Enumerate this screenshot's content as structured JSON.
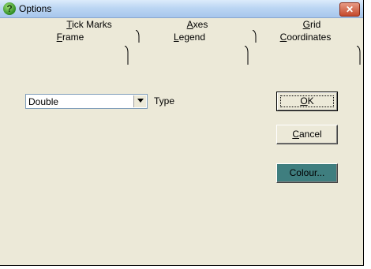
{
  "window": {
    "title": "Options"
  },
  "tabs_back": [
    {
      "mnemonic": "T",
      "rest": "ick Marks"
    },
    {
      "mnemonic": "A",
      "rest": "xes"
    },
    {
      "mnemonic": "G",
      "rest": "rid"
    }
  ],
  "tabs_front": [
    {
      "mnemonic": "F",
      "rest": "rame"
    },
    {
      "mnemonic": "L",
      "rest": "egend"
    },
    {
      "mnemonic": "C",
      "rest": "oordinates"
    }
  ],
  "frame": {
    "type_select": {
      "value": "Double"
    },
    "type_label": "Type"
  },
  "buttons": {
    "ok": {
      "mnemonic": "O",
      "rest": "K"
    },
    "cancel": {
      "mnemonic": "C",
      "rest": "ancel"
    },
    "colour": {
      "label": "Colour..."
    }
  },
  "colors": {
    "colour_button_bg": "#3f7e7f",
    "window_bg": "#ece9d8"
  },
  "icons": {
    "title": "help-question-icon",
    "close": "close-x-icon",
    "dropdown": "chevron-down-icon"
  }
}
